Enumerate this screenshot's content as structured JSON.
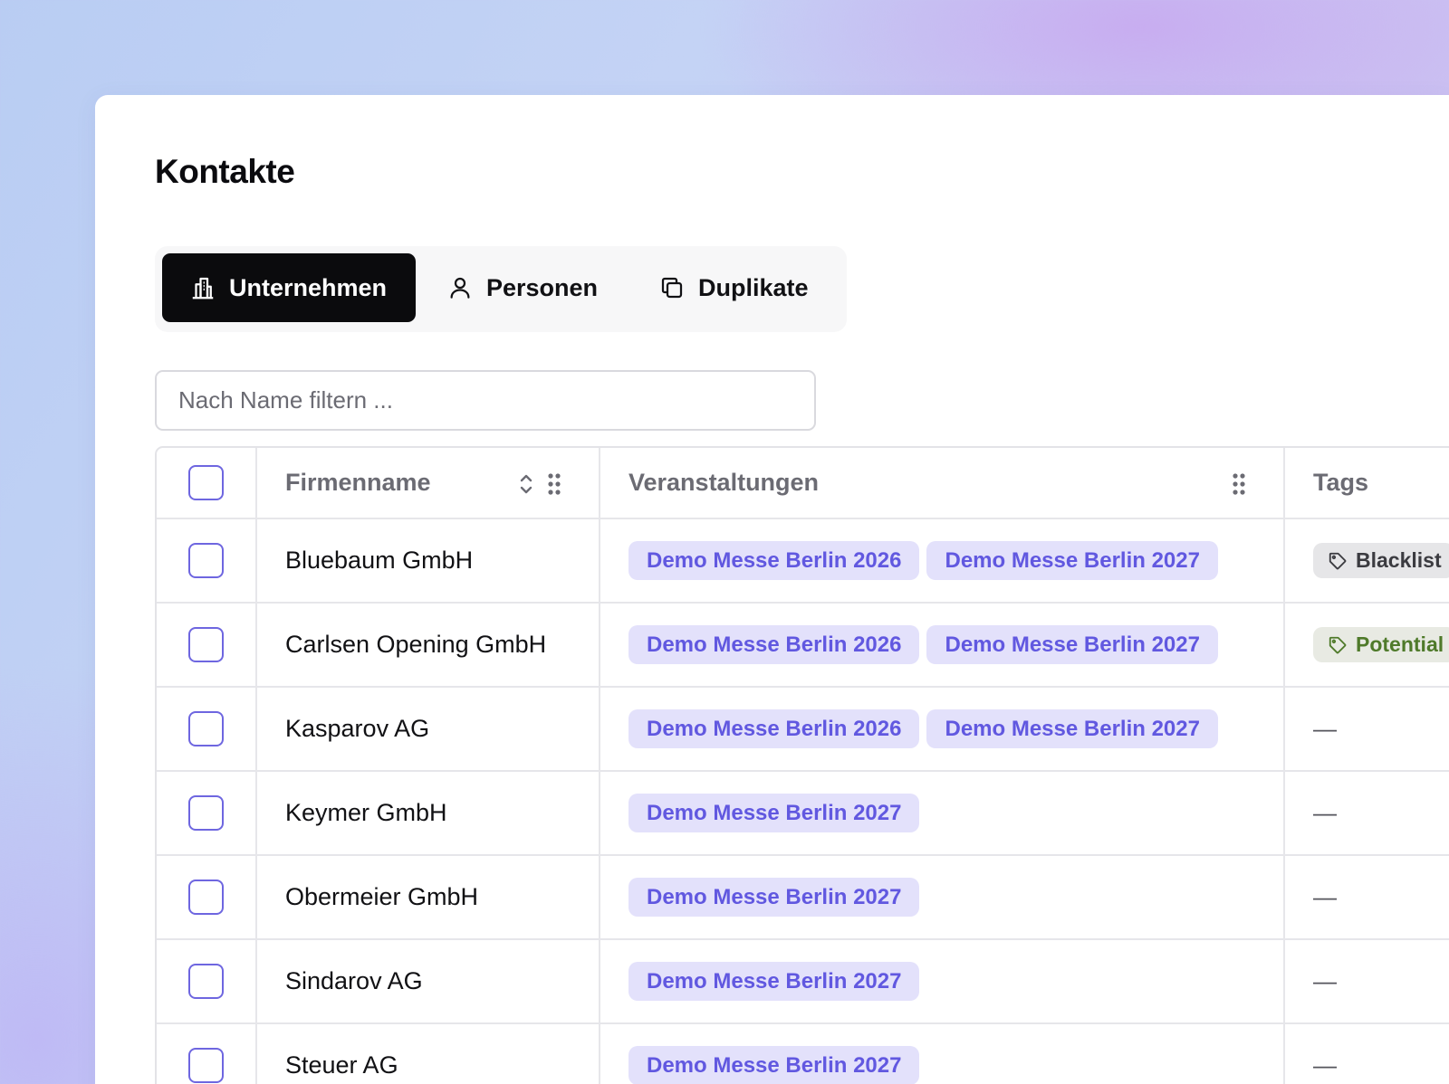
{
  "page": {
    "title": "Kontakte"
  },
  "tabs": [
    {
      "label": "Unternehmen",
      "icon": "building-icon",
      "active": true
    },
    {
      "label": "Personen",
      "icon": "person-icon",
      "active": false
    },
    {
      "label": "Duplikate",
      "icon": "duplicate-icon",
      "active": false
    }
  ],
  "search": {
    "placeholder": "Nach Name filtern ..."
  },
  "table": {
    "headers": {
      "name": "Firmenname",
      "events": "Veranstaltungen",
      "tags": "Tags"
    },
    "rows": [
      {
        "name": "Bluebaum GmbH",
        "events": [
          "Demo Messe Berlin 2026",
          "Demo Messe Berlin 2027"
        ],
        "tag": {
          "label": "Blacklist",
          "style": "grey"
        }
      },
      {
        "name": "Carlsen Opening GmbH",
        "events": [
          "Demo Messe Berlin 2026",
          "Demo Messe Berlin 2027"
        ],
        "tag": {
          "label": "Potential",
          "style": "green"
        }
      },
      {
        "name": "Kasparov AG",
        "events": [
          "Demo Messe Berlin 2026",
          "Demo Messe Berlin 2027"
        ],
        "tag": null
      },
      {
        "name": "Keymer GmbH",
        "events": [
          "Demo Messe Berlin 2027"
        ],
        "tag": null
      },
      {
        "name": "Obermeier GmbH",
        "events": [
          "Demo Messe Berlin 2027"
        ],
        "tag": null
      },
      {
        "name": "Sindarov AG",
        "events": [
          "Demo Messe Berlin 2027"
        ],
        "tag": null
      },
      {
        "name": "Steuer AG",
        "events": [
          "Demo Messe Berlin 2027"
        ],
        "tag": null
      }
    ],
    "empty_tag": "—"
  },
  "colors": {
    "accent": "#6158e0",
    "event_pill_bg": "#e3e1fb",
    "tag_grey_bg": "#e6e6e8",
    "tag_green_text": "#4f7a2a",
    "active_tab_bg": "#0b0b0d"
  }
}
